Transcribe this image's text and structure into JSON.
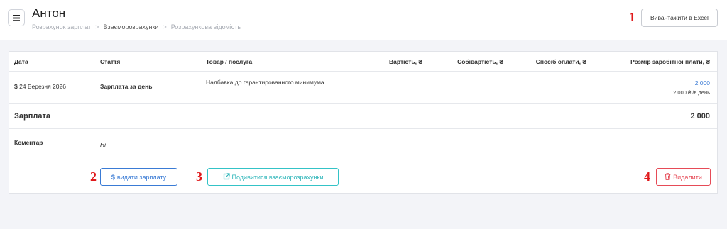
{
  "header": {
    "title": "Антон",
    "breadcrumbs": [
      "Розрахунок зарплат",
      "Взаєморозрахунки",
      "Розрахункова відомість"
    ],
    "export_button": "Вивантажити в Excel"
  },
  "table": {
    "columns": [
      "Дата",
      "Стаття",
      "Товар / послуга",
      "Вартість, ₴",
      "Собівартість, ₴",
      "Спосіб оплати, ₴",
      "Розмір заробітної плати, ₴"
    ],
    "row": {
      "date_symbol": "$",
      "date": "24 Березня 2026",
      "article": "Зарплата за день",
      "product": "Надбавка до гарантированного минимума",
      "salary": "2 000",
      "salary_rate": "2 000 ₴ /в день"
    },
    "summary": {
      "label": "Зарплата",
      "total": "2 000"
    },
    "comment": {
      "label": "Коментар",
      "value": "Hi"
    }
  },
  "actions": {
    "pay_icon": "$",
    "pay": "видати зарплату",
    "view": "Подивитися взаєморозрахунки",
    "delete": "Видалити"
  },
  "markers": [
    "1",
    "2",
    "3",
    "4"
  ],
  "colors": {
    "primary": "#3a7bd5",
    "info": "#34c3c7",
    "danger": "#e64b57",
    "marker": "#e0191b"
  },
  "icons": [
    "menu-icon",
    "external-link-icon",
    "trash-icon"
  ]
}
